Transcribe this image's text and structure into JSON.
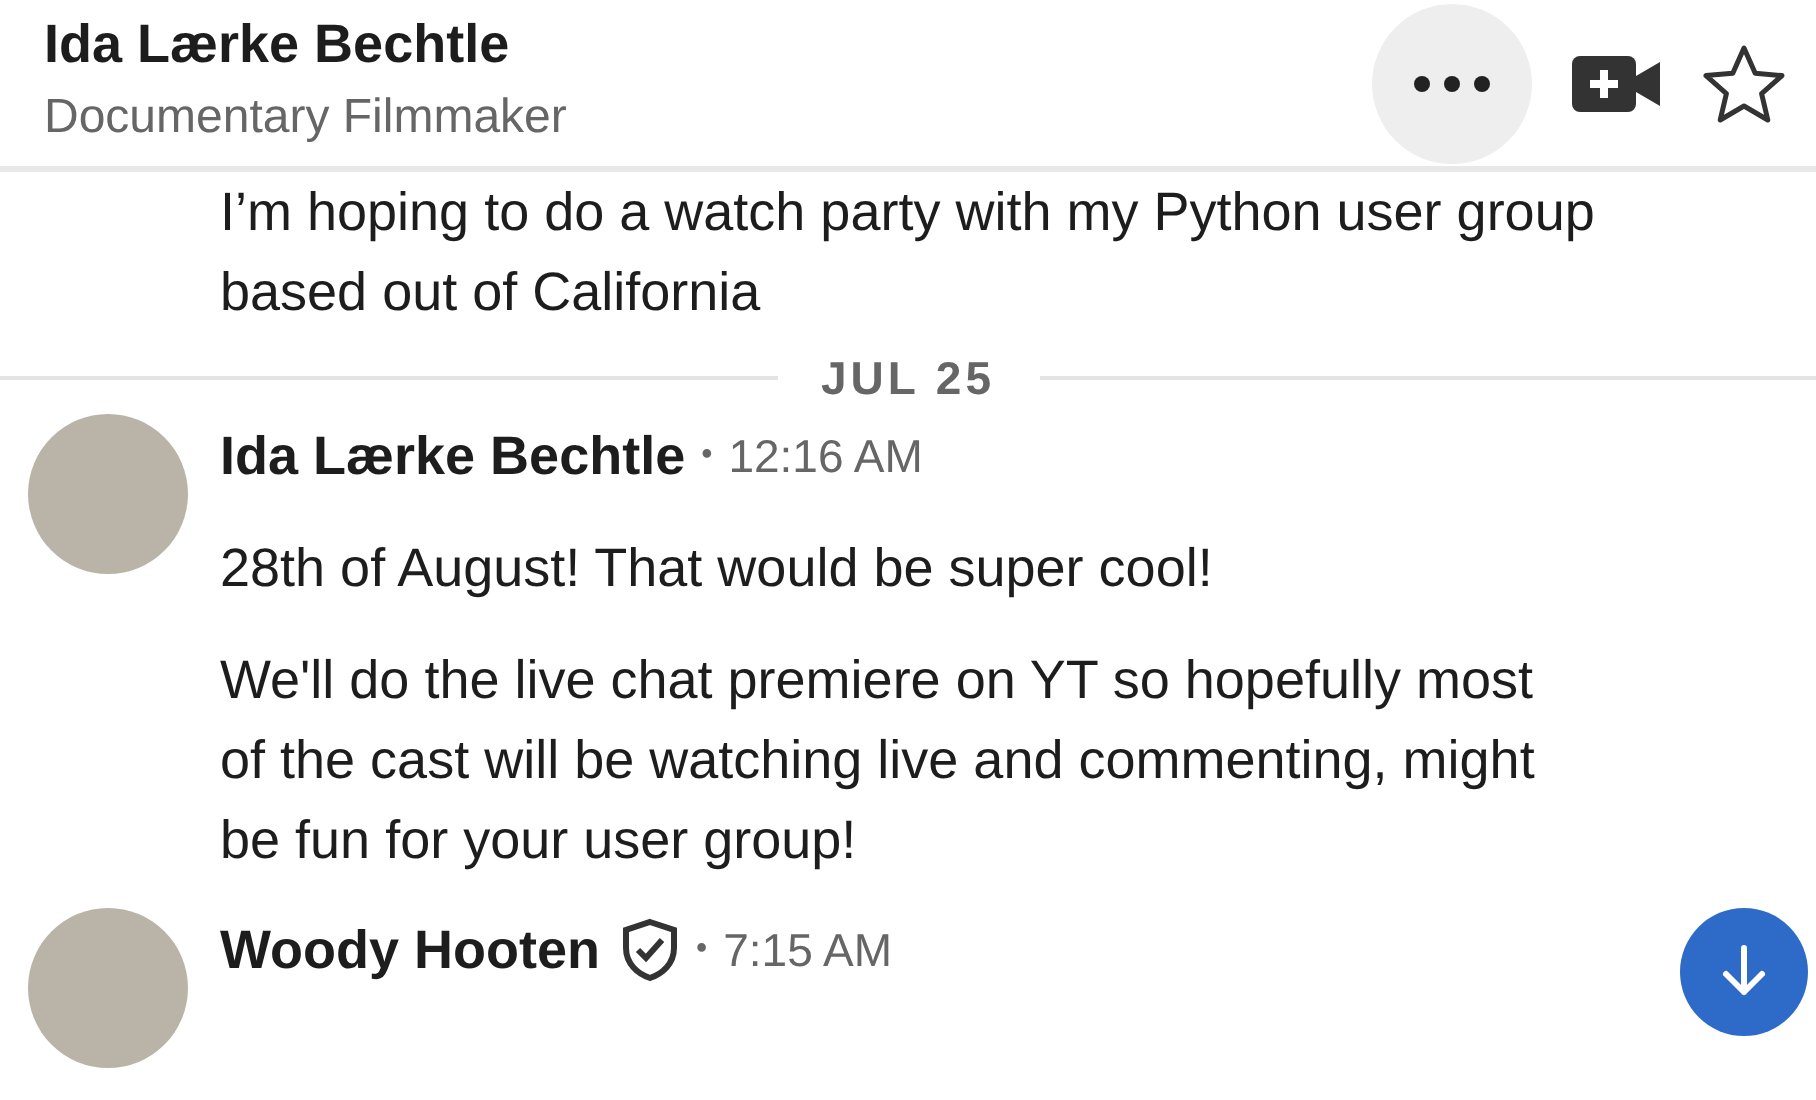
{
  "header": {
    "name": "Ida Lærke Bechtle",
    "subtitle": "Documentary Filmmaker"
  },
  "previous_message": {
    "text": "I’m hoping to do a watch party with my Python user group based out of California"
  },
  "date_divider": "JUL 25",
  "messages": [
    {
      "sender": "Ida Lærke Bechtle",
      "verified": false,
      "separator": "•",
      "time": "12:16 AM",
      "paragraphs": [
        "28th of August! That would be super cool!",
        "We'll do the live chat premiere on YT so hopefully most of the cast will be watching live and commenting, might be fun for your user group!"
      ]
    },
    {
      "sender": "Woody Hooten",
      "verified": true,
      "separator": "•",
      "time": "7:15 AM"
    }
  ]
}
